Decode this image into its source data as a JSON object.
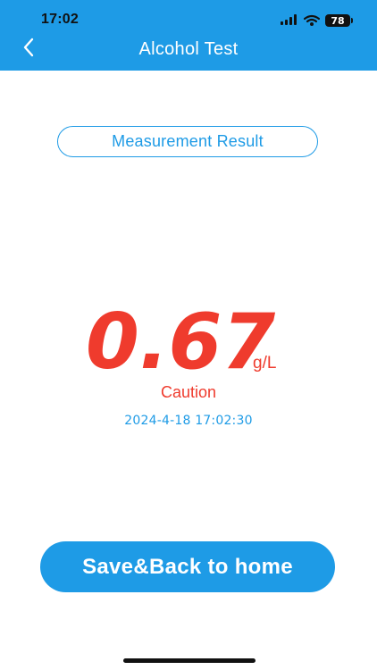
{
  "status_bar": {
    "time": "17:02",
    "battery_level": "78",
    "signal_icon": "cellular-signal-icon",
    "wifi_icon": "wifi-icon",
    "battery_icon": "battery-icon"
  },
  "nav": {
    "title": "Alcohol Test",
    "back_icon": "chevron-left-icon"
  },
  "result": {
    "label": "Measurement Result",
    "value": "0.67",
    "unit": "g/L",
    "status": "Caution",
    "timestamp": "2024-4-18 17:02:30"
  },
  "actions": {
    "save_back_label": "Save&Back to home"
  },
  "colors": {
    "primary": "#1e9be6",
    "alert": "#ef3b2d",
    "background": "#ffffff"
  }
}
